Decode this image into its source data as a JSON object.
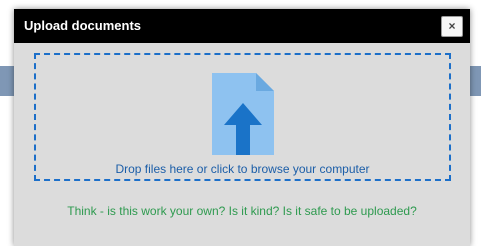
{
  "dialog": {
    "title": "Upload documents",
    "close_label": "×"
  },
  "dropzone": {
    "text": "Drop files here or click to browse your computer",
    "icon": "file-upload-icon"
  },
  "hint": {
    "text": "Think - is this work your own? Is it kind? Is it safe to be uploaded?"
  },
  "colors": {
    "header_bg": "#000000",
    "dialog_bg": "#dcdcdc",
    "dropzone_border": "#1c6fc9",
    "drop_text": "#1c5ea8",
    "hint_text": "#2e9a4f",
    "icon_file": "#8ec2f0",
    "icon_arrow": "#1a73c8"
  }
}
